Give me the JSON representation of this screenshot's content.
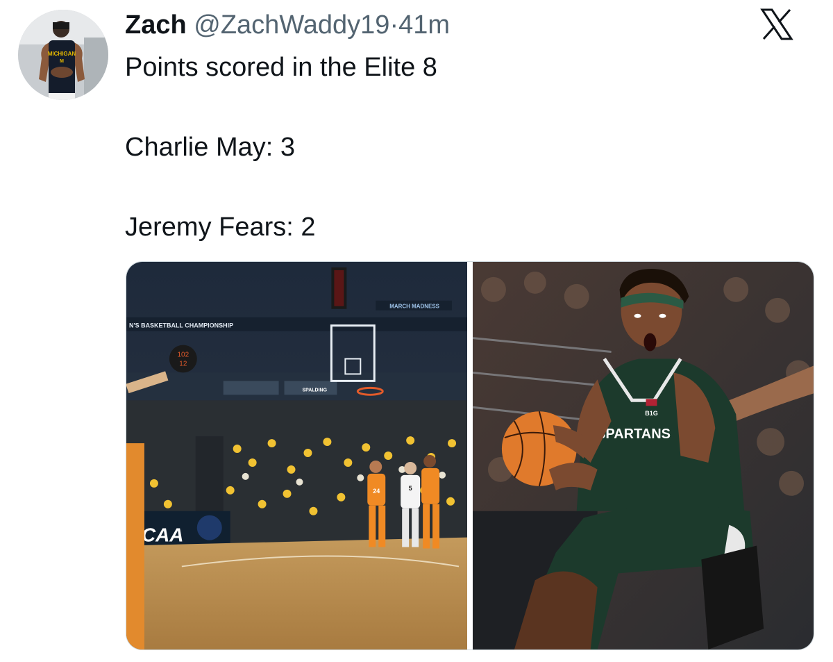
{
  "tweet": {
    "author_name": "Zach",
    "author_handle": "@ZachWaddy19",
    "separator": "·",
    "timestamp": "41m",
    "lines": [
      "Points scored in the Elite 8",
      "Charlie May: 3",
      "Jeremy Fears: 2"
    ]
  },
  "icons": {
    "platform": "x-logo-icon"
  },
  "media": {
    "left_photo": {
      "arena_banner": "N'S BASKETBALL CHAMPIONSHIP",
      "march_madness_banner": "MARCH MADNESS",
      "shot_clock_top": "102",
      "shot_clock_bottom": "12",
      "courtside_sign": "CAA",
      "backboard_brand": "SPALDING",
      "jersey_orange": "24",
      "jersey_white": "5"
    },
    "right_photo": {
      "jersey_text": "SPARTANS",
      "conference_mark": "B1G"
    }
  },
  "colors": {
    "text": "#0f1419",
    "secondary": "#536471",
    "spartan_green": "#1c3a2c",
    "tennessee_orange": "#f08a24",
    "michigan_maize": "#f4d03f"
  }
}
